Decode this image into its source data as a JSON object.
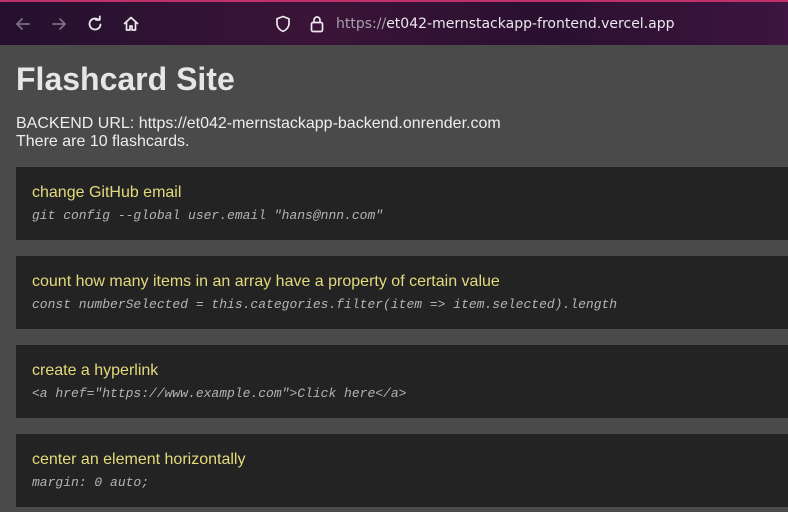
{
  "browser": {
    "url_scheme": "https://",
    "url_host": "et042-mernstackapp-frontend.vercel.app"
  },
  "page": {
    "title": "Flashcard Site",
    "backend_label": "BACKEND URL: https://et042-mernstackapp-backend.onrender.com",
    "count_text": "There are 10 flashcards."
  },
  "flashcards": [
    {
      "front": "change GitHub email",
      "back": "git config --global user.email \"hans@nnn.com\""
    },
    {
      "front": "count how many items in an array have a property of certain value",
      "back": "const numberSelected = this.categories.filter(item => item.selected).length"
    },
    {
      "front": "create a hyperlink",
      "back": "<a href=\"https://www.example.com\">Click here</a>"
    },
    {
      "front": "center an element horizontally",
      "back": "margin: 0 auto;"
    }
  ],
  "icons": {
    "back": "arrow-left-icon",
    "forward": "arrow-right-icon",
    "reload": "reload-icon",
    "home": "home-icon",
    "shield": "shield-icon",
    "lock": "lock-icon"
  },
  "colors": {
    "page_background": "#4a4a4a",
    "card_background": "#232323",
    "card_front_text": "#e3da7c",
    "card_back_text": "#b4b4b4"
  }
}
